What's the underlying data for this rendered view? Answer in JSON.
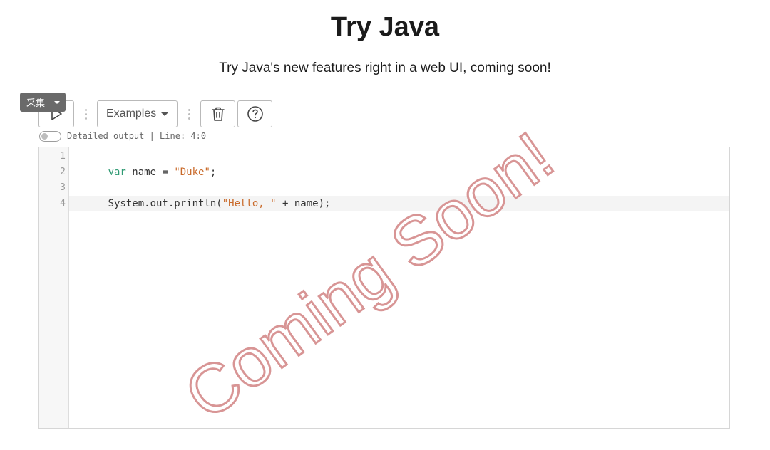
{
  "header": {
    "title": "Try Java",
    "subtitle": "Try Java's new features right in a web UI, coming soon!"
  },
  "overlay": {
    "collect_label": "采集"
  },
  "toolbar": {
    "run_icon": "play-icon",
    "examples_label": "Examples",
    "examples_icon": "caret-down-icon",
    "clear_icon": "trash-icon",
    "help_icon": "help-circle-icon"
  },
  "status": {
    "detailed_output_enabled": false,
    "text": "Detailed output | Line: 4:0"
  },
  "editor": {
    "line_numbers": [
      "1",
      "2",
      "3",
      "4"
    ],
    "lines": [
      [
        {
          "text": "var",
          "type": "keyword"
        },
        {
          "text": " name = ",
          "type": "plain"
        },
        {
          "text": "\"Duke\"",
          "type": "string"
        },
        {
          "text": ";",
          "type": "plain"
        }
      ],
      [],
      [
        {
          "text": "System.out.println(",
          "type": "plain"
        },
        {
          "text": "\"Hello, \"",
          "type": "string"
        },
        {
          "text": " + name);",
          "type": "plain"
        }
      ],
      []
    ],
    "active_line": 4
  },
  "watermark": {
    "text": "Coming Soon!"
  },
  "colors": {
    "keyword": "#2f9a73",
    "string": "#c96a2a",
    "watermark_outline": "#d89595"
  }
}
